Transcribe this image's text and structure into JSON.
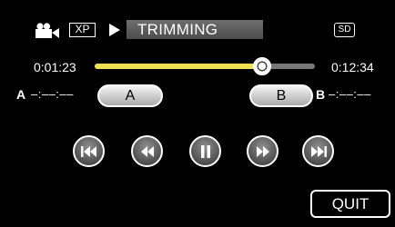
{
  "header": {
    "mode_icon": "movie-camera-icon",
    "quality": "XP",
    "play_icon": "play-triangle-icon",
    "mode_label": "TRIMMING",
    "media": "SD"
  },
  "timeline": {
    "current_time": "0:01:23",
    "total_time": "0:12:34",
    "progress_fraction": 0.76,
    "track_color": "#777777",
    "fill_color": "#f0e04a"
  },
  "trim": {
    "a_letter": "A",
    "a_time": "–:––:––",
    "a_button_label": "A",
    "b_button_label": "B",
    "b_letter": "B",
    "b_time": "–:––:––"
  },
  "controls": [
    {
      "id": "skip-prev",
      "icon": "skip-previous-icon"
    },
    {
      "id": "rewind",
      "icon": "rewind-icon"
    },
    {
      "id": "pause",
      "icon": "pause-icon"
    },
    {
      "id": "fast-forward",
      "icon": "fast-forward-icon"
    },
    {
      "id": "skip-next",
      "icon": "skip-next-icon"
    }
  ],
  "quit_label": "QUIT"
}
